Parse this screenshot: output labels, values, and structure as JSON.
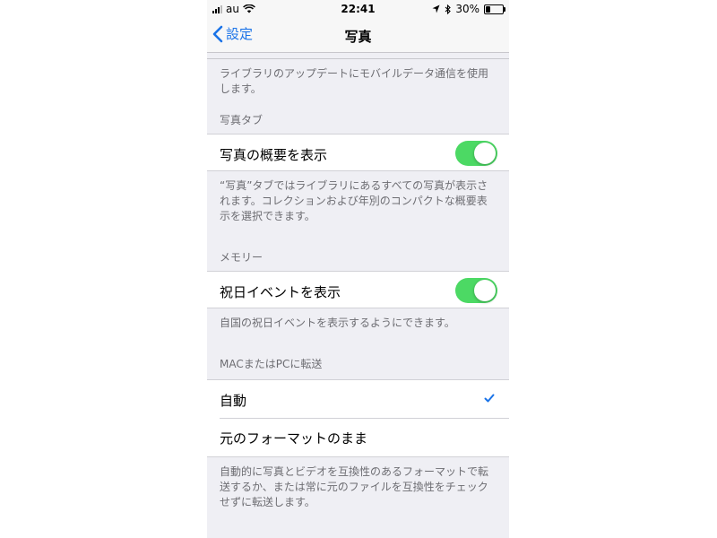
{
  "status_bar": {
    "carrier": "au",
    "time": "22:41",
    "battery_percent": "30%",
    "battery_level": 0.3
  },
  "nav": {
    "back_label": "設定",
    "title": "写真"
  },
  "sections": {
    "cellular_footer": "ライブラリのアップデートにモバイルデータ通信を使用します。",
    "photos_tab": {
      "header": "写真タブ",
      "toggle_label": "写真の概要を表示",
      "toggle_on": true,
      "footer": "“写真”タブではライブラリにあるすべての写真が表示されます。コレクションおよび年別のコンパクトな概要表示を選択できます。"
    },
    "memories": {
      "header": "メモリー",
      "toggle_label": "祝日イベントを表示",
      "toggle_on": true,
      "footer": "自国の祝日イベントを表示するようにできます。"
    },
    "transfer": {
      "header": "MACまたはPCに転送",
      "options": [
        {
          "label": "自動",
          "selected": true
        },
        {
          "label": "元のフォーマットのまま",
          "selected": false
        }
      ],
      "footer": "自動的に写真とビデオを互換性のあるフォーマットで転送するか、または常に元のファイルを互換性をチェックせずに転送します。"
    }
  },
  "colors": {
    "accent": "#1a73e8",
    "toggle_on": "#4cd964",
    "background": "#efeff4"
  }
}
